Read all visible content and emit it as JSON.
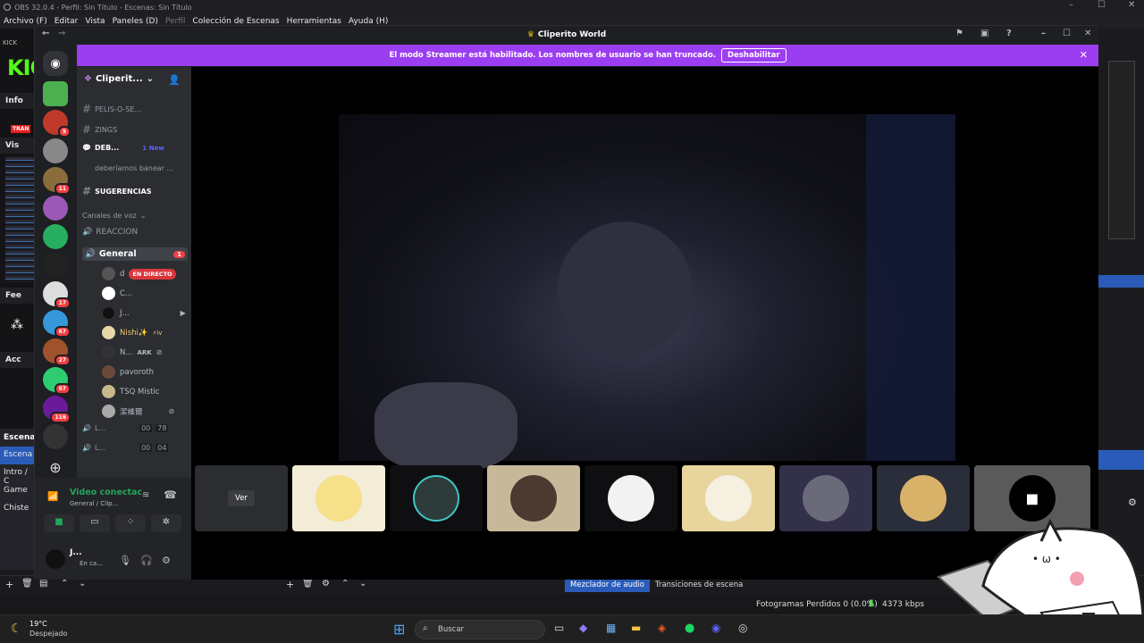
{
  "obs": {
    "window_title": "OBS 32.0.4 - Perfil: Sin Título - Escenas: Sin Título",
    "menu": [
      "Archivo (F)",
      "Editar",
      "Vista",
      "Paneles (D)",
      "Perfil",
      "Colección de Escenas",
      "Herramientas",
      "Ayuda (H)"
    ],
    "dock_tab": "KICK",
    "kick_logo": "KIC",
    "side_labels": {
      "info": "Info",
      "vis": "Vis",
      "trans": "TRAN",
      "fee": "Fee",
      "acc": "Acc"
    },
    "scenes_title": "Escenas",
    "scenes": [
      "Escena",
      "Intro / C",
      "Game",
      "Chiste"
    ],
    "mixer_tab": "Mezclador de audio",
    "transitions_tab": "Transiciones de escena",
    "frames_dropped": "Fotogramas Perdidos 0 (0.0%)",
    "bitrate": "4373 kbps"
  },
  "discord": {
    "window_title": "Cliperito World",
    "banner_text": "El modo Streamer está habilitado. Los nombres de usuario se han truncado.",
    "banner_button": "Deshabilitar",
    "server_name": "Cliperit...",
    "channels": [
      {
        "name": "PELIS-O-SE..."
      },
      {
        "name": "ZINGS"
      },
      {
        "name": "DEB...",
        "badge": "1 New"
      },
      {
        "name": "deberíamos banear ..."
      },
      {
        "name": "SUGERENCIAS"
      }
    ],
    "voice_category": "Canales de voz",
    "voice_channels": [
      {
        "name": "REACCION"
      },
      {
        "name": "General",
        "badge": "1"
      }
    ],
    "members": [
      {
        "name": "d",
        "live": "EN DIRECTO"
      },
      {
        "name": "C..."
      },
      {
        "name": "J..."
      },
      {
        "name": "Nishi✨",
        "tag": "⚡iv"
      },
      {
        "name": "N...",
        "tag": "ARK"
      },
      {
        "name": "pavoroth"
      },
      {
        "name": "TSQ Mistic"
      },
      {
        "name": "潔維爾"
      }
    ],
    "extra_channels": [
      {
        "name": "L...",
        "counts": [
          "00",
          "78"
        ]
      },
      {
        "name": "L...",
        "counts": [
          "00",
          "04"
        ]
      }
    ],
    "server_badges": [
      "5",
      "11",
      "17",
      "67",
      "27",
      "67",
      "116"
    ],
    "voice_status": "Video conectac",
    "voice_location": "General / Clip...",
    "user_name": "J...",
    "user_status": "En ca...",
    "tile_button": "Ver"
  },
  "taskbar": {
    "temperature": "19°C",
    "weather": "Despejado",
    "search_placeholder": "Buscar"
  },
  "colors": {
    "streamer_banner": "#9b3ef1",
    "live_badge": "#da373c",
    "kick_green": "#53fc18",
    "discord_bg": "#1e1f22"
  }
}
